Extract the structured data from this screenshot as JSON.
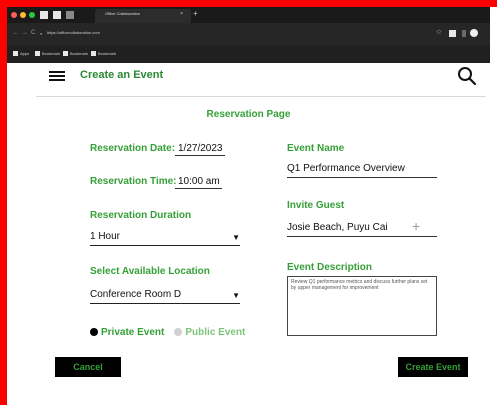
{
  "browser": {
    "tab_title": "Office Collaboration",
    "tab_close": "×",
    "new_tab": "+",
    "url": "https://officecollaboration.com",
    "star": "☆",
    "bookmarks": [
      "Apps",
      "Bookmark",
      "Bookmark",
      "Bookmark"
    ]
  },
  "header": {
    "title": "Create an Event"
  },
  "page": {
    "title": "Reservation Page"
  },
  "form": {
    "reservation_date_label": "Reservation Date:",
    "reservation_date_value": "1/27/2023",
    "reservation_time_label": "Reservation Time:",
    "reservation_time_value": "10:00 am",
    "duration_label": "Reservation Duration",
    "duration_value": "1 Hour",
    "location_label": "Select Available Location",
    "location_value": "Conference Room D",
    "event_name_label": "Event Name",
    "event_name_value": "Q1 Performance Overview",
    "invite_guest_label": "Invite Guest",
    "invite_guest_value": "Josie Beach, Puyu Cai",
    "invite_plus": "+",
    "event_description_label": "Event Description",
    "event_description_value": "Review Q1 performance metrics and discuss further plans set by upper management for improvement",
    "private_label": "Private Event",
    "public_label": "Public Event",
    "caret": "▼"
  },
  "buttons": {
    "cancel": "Cancel",
    "create": "Create Event"
  },
  "colors": {
    "accent": "#36a038",
    "frame": "#ff0000",
    "private_radio": "#000000",
    "public_radio": "#d0d0d0",
    "public_label": "#7cc67a"
  }
}
